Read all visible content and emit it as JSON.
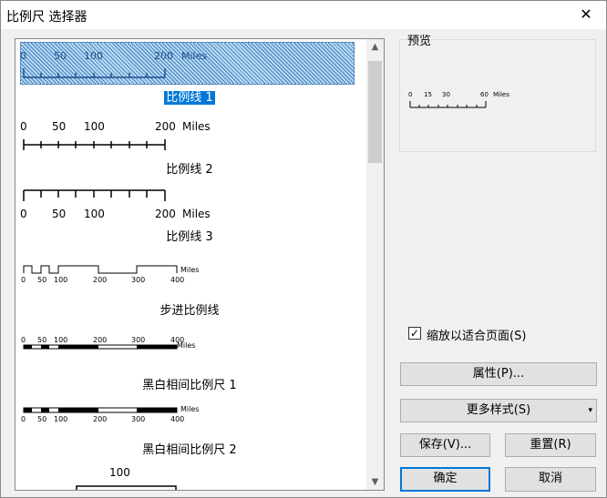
{
  "window": {
    "title": "比例尺 选择器",
    "close_glyph": "✕"
  },
  "list": {
    "items": [
      {
        "label": "比例线 1",
        "ticks": [
          "0",
          "50",
          "100",
          "200"
        ],
        "units": "Miles",
        "selected": true
      },
      {
        "label": "比例线 2",
        "ticks": [
          "0",
          "50",
          "100",
          "200"
        ],
        "units": "Miles"
      },
      {
        "label": "比例线 3",
        "ticks": [
          "0",
          "50",
          "100",
          "200"
        ],
        "units": "Miles"
      },
      {
        "label": "步进比例线",
        "ticks": [
          "0",
          "50",
          "100",
          "200",
          "300",
          "400"
        ],
        "units": "Miles"
      },
      {
        "label": "黑白相间比例尺 1",
        "ticks": [
          "0",
          "50",
          "100",
          "200",
          "300",
          "400"
        ],
        "units": "Miles"
      },
      {
        "label": "黑白相间比例尺 2",
        "ticks": [
          "0",
          "50",
          "100",
          "200",
          "300",
          "400"
        ],
        "units": "Miles"
      },
      {
        "label": "",
        "ticks": [
          "100"
        ],
        "units": ""
      }
    ]
  },
  "preview": {
    "label": "预览",
    "ticks": [
      "0",
      "15",
      "30",
      "60"
    ],
    "units": "Miles"
  },
  "options": {
    "fit_to_page_label": "缩放以适合页面(S)",
    "fit_to_page_checked": "✓"
  },
  "buttons": {
    "properties": "属性(P)...",
    "more_styles": "更多样式(S)",
    "more_styles_arrow": "▾",
    "save": "保存(V)...",
    "reset": "重置(R)",
    "ok": "确定",
    "cancel": "取消"
  },
  "scrollbar": {
    "up_arrow": "▲",
    "down_arrow": "▼"
  }
}
